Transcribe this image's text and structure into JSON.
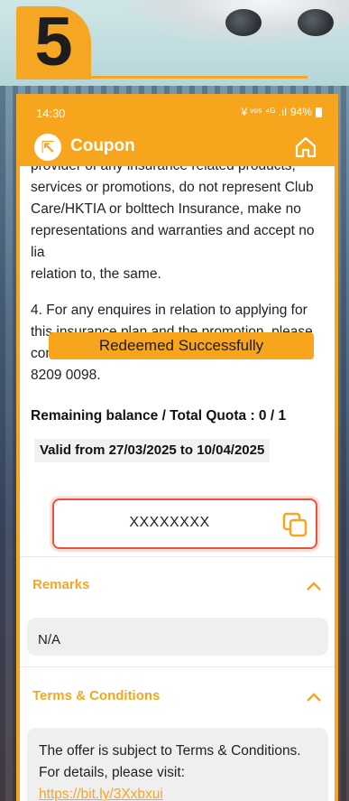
{
  "step": {
    "number": "5"
  },
  "status_bar": {
    "time": "14:30",
    "indicators": "¥ ᵛᵒ⁵ ⁴ᴳ .ıl",
    "battery": "94%"
  },
  "app_bar": {
    "title": "Coupon",
    "back_icon": "back-arrow-icon",
    "home_icon": "home-icon"
  },
  "content": {
    "para_partial": "provider of any insurance related products, services or promotions, do not represent Club Care/HKTIA or bolttech Insurance, make no representations and warranties and accept no lia",
    "para_partial_end": "relation to, the same.",
    "para_4": "4. For any enquires in relation to applying for this insurance plan and the promotion, please contact Club Care Customer Service Hotline 8209 0098.",
    "balance": "Remaining balance / Total Quota : 0 / 1",
    "valid": "Valid from 27/03/2025 to 10/04/2025"
  },
  "coupon": {
    "code": "XXXXXXXX",
    "copy_icon": "copy-icon"
  },
  "remarks": {
    "title": "Remarks",
    "value": "N/A"
  },
  "terms": {
    "title": "Terms & Conditions",
    "text": "The offer is subject to Terms & Conditions. For details, please visit:",
    "link": "https://bit.ly/3Xxbxui"
  },
  "toast": {
    "message": "Redeemed Successfully"
  },
  "colors": {
    "accent": "#f7a51d",
    "code_border": "#e6543d"
  }
}
